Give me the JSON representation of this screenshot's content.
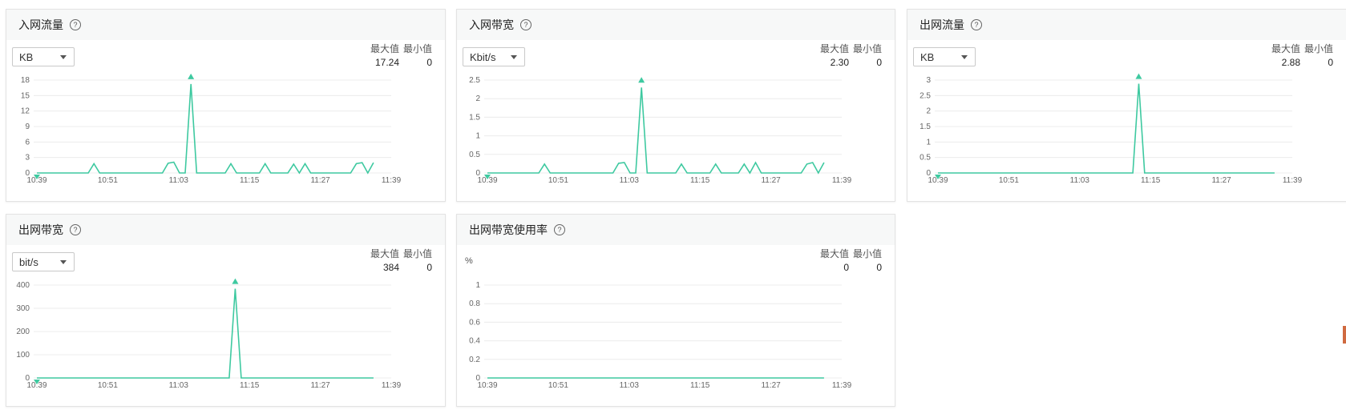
{
  "accent_color": "#3ec9a0",
  "panels": [
    {
      "title": "入网流量",
      "help_icon": "question-circle-icon",
      "unit": "KB",
      "stats": {
        "max_label": "最大值",
        "min_label": "最小值",
        "max": "17.24",
        "min": "0"
      },
      "chart_data": {
        "type": "line",
        "x_ticks": [
          "10:39",
          "10:51",
          "11:03",
          "11:15",
          "11:27",
          "11:39"
        ],
        "y_ticks": [
          "18",
          "15",
          "12",
          "9",
          "6",
          "3",
          "0"
        ],
        "ylim": [
          0,
          18
        ],
        "values": [
          0,
          0,
          0,
          0,
          0,
          0,
          0,
          0,
          0,
          0,
          1.8,
          0,
          0,
          0,
          0,
          0,
          0,
          0,
          0,
          0,
          0,
          0,
          0,
          1.9,
          2.1,
          0,
          0,
          17.24,
          0,
          0,
          0,
          0,
          0,
          0,
          1.8,
          0,
          0,
          0,
          0,
          0,
          1.8,
          0,
          0,
          0,
          0,
          1.7,
          0,
          1.8,
          0,
          0,
          0,
          0,
          0,
          0,
          0,
          0,
          1.8,
          2.0,
          0,
          2.0
        ],
        "max_marker_index": 27
      }
    },
    {
      "title": "入网带宽",
      "help_icon": "question-circle-icon",
      "unit": "Kbit/s",
      "stats": {
        "max_label": "最大值",
        "min_label": "最小值",
        "max": "2.30",
        "min": "0"
      },
      "chart_data": {
        "type": "line",
        "x_ticks": [
          "10:39",
          "10:51",
          "11:03",
          "11:15",
          "11:27",
          "11:39"
        ],
        "y_ticks": [
          "2.5",
          "2",
          "1.5",
          "1",
          "0.5",
          "0"
        ],
        "ylim": [
          0,
          2.5
        ],
        "values": [
          0,
          0,
          0,
          0,
          0,
          0,
          0,
          0,
          0,
          0,
          0.24,
          0,
          0,
          0,
          0,
          0,
          0,
          0,
          0,
          0,
          0,
          0,
          0,
          0.26,
          0.28,
          0,
          0,
          2.3,
          0,
          0,
          0,
          0,
          0,
          0,
          0.24,
          0,
          0,
          0,
          0,
          0,
          0.24,
          0,
          0,
          0,
          0,
          0.24,
          0,
          0.28,
          0,
          0,
          0,
          0,
          0,
          0,
          0,
          0,
          0.24,
          0.28,
          0,
          0.28
        ],
        "max_marker_index": 27
      }
    },
    {
      "title": "出网流量",
      "help_icon": "question-circle-icon",
      "unit": "KB",
      "stats": {
        "max_label": "最大值",
        "min_label": "最小值",
        "max": "2.88",
        "min": "0"
      },
      "chart_data": {
        "type": "line",
        "x_ticks": [
          "10:39",
          "10:51",
          "11:03",
          "11:15",
          "11:27",
          "11:39"
        ],
        "y_ticks": [
          "3",
          "2.5",
          "2",
          "1.5",
          "1",
          "0.5",
          "0"
        ],
        "ylim": [
          0,
          3
        ],
        "values": [
          0,
          0,
          0,
          0,
          0,
          0,
          0,
          0,
          0,
          0,
          0,
          0,
          0,
          0,
          0,
          0,
          0,
          0,
          0,
          0,
          0,
          0,
          0,
          0,
          0,
          0,
          0,
          0,
          0,
          0,
          0,
          0,
          0,
          0,
          2.88,
          0,
          0,
          0,
          0,
          0,
          0,
          0,
          0,
          0,
          0,
          0,
          0,
          0,
          0,
          0,
          0,
          0,
          0,
          0,
          0,
          0,
          0,
          0
        ],
        "max_marker_index": 34
      }
    },
    {
      "title": "出网带宽",
      "help_icon": "question-circle-icon",
      "unit": "bit/s",
      "stats": {
        "max_label": "最大值",
        "min_label": "最小值",
        "max": "384",
        "min": "0"
      },
      "chart_data": {
        "type": "line",
        "x_ticks": [
          "10:39",
          "10:51",
          "11:03",
          "11:15",
          "11:27",
          "11:39"
        ],
        "y_ticks": [
          "400",
          "300",
          "200",
          "100",
          "0"
        ],
        "ylim": [
          0,
          400
        ],
        "values": [
          0,
          0,
          0,
          0,
          0,
          0,
          0,
          0,
          0,
          0,
          0,
          0,
          0,
          0,
          0,
          0,
          0,
          0,
          0,
          0,
          0,
          0,
          0,
          0,
          0,
          0,
          0,
          0,
          0,
          0,
          0,
          0,
          0,
          384,
          0,
          0,
          0,
          0,
          0,
          0,
          0,
          0,
          0,
          0,
          0,
          0,
          0,
          0,
          0,
          0,
          0,
          0,
          0,
          0,
          0,
          0,
          0
        ],
        "max_marker_index": 33
      }
    },
    {
      "title": "出网带宽使用率",
      "help_icon": "question-circle-icon",
      "unit_label": "%",
      "stats": {
        "max_label": "最大值",
        "min_label": "最小值",
        "max": "0",
        "min": "0"
      },
      "chart_data": {
        "type": "line",
        "x_ticks": [
          "10:39",
          "10:51",
          "11:03",
          "11:15",
          "11:27",
          "11:39"
        ],
        "y_ticks": [
          "1",
          "0.8",
          "0.6",
          "0.4",
          "0.2",
          "0"
        ],
        "ylim": [
          0,
          1
        ],
        "values": [
          0,
          0,
          0,
          0,
          0,
          0,
          0,
          0,
          0,
          0,
          0,
          0,
          0,
          0,
          0,
          0,
          0,
          0,
          0,
          0,
          0,
          0,
          0,
          0,
          0,
          0,
          0,
          0,
          0,
          0,
          0,
          0,
          0,
          0,
          0,
          0,
          0,
          0,
          0,
          0,
          0,
          0,
          0,
          0,
          0,
          0,
          0,
          0,
          0,
          0,
          0,
          0,
          0,
          0,
          0,
          0,
          0,
          0
        ]
      }
    }
  ]
}
